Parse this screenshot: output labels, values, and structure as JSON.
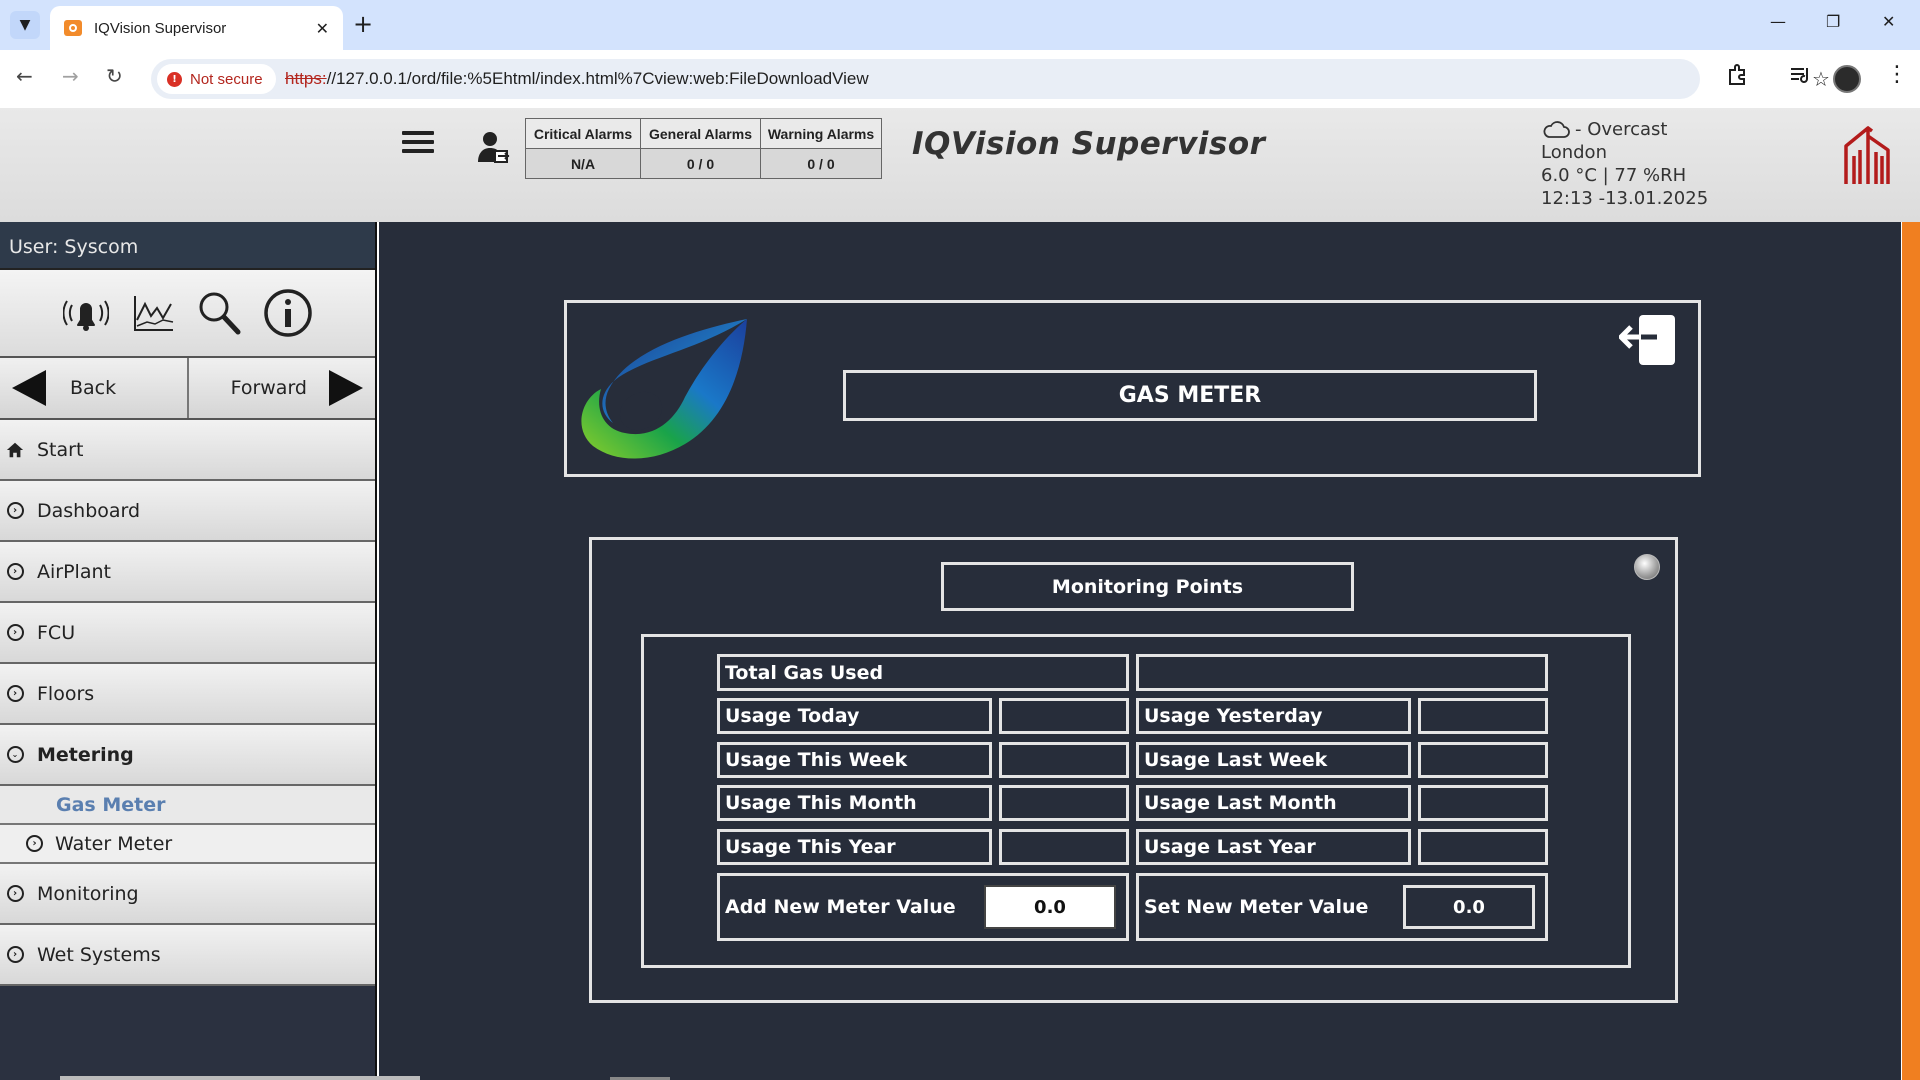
{
  "browser": {
    "tab_title": "IQVision Supervisor",
    "security_label": "Not secure",
    "url_scheme": "https:",
    "url_rest": "//127.0.0.1/ord/file:%5Ehtml/index.html%7Cview:web:FileDownloadView"
  },
  "header": {
    "brand": "IQVision Supervisor",
    "alarms": {
      "headers": [
        "Critical Alarms",
        "General Alarms",
        "Warning Alarms"
      ],
      "values": [
        "N/A",
        "0 / 0",
        "0 / 0"
      ]
    },
    "weather": {
      "condition": "- Overcast",
      "city": "London",
      "reading": "6.0 °C | 77 %RH",
      "datetime": "12:13 -13.01.2025"
    }
  },
  "sidebar": {
    "user": "User: Syscom",
    "back_label": "Back",
    "forward_label": "Forward",
    "items": [
      {
        "label": "Start"
      },
      {
        "label": "Dashboard"
      },
      {
        "label": "AirPlant"
      },
      {
        "label": "FCU"
      },
      {
        "label": "Floors"
      },
      {
        "label": "Metering"
      },
      {
        "label": "Gas Meter"
      },
      {
        "label": "Water Meter"
      },
      {
        "label": "Monitoring"
      },
      {
        "label": "Wet Systems"
      }
    ]
  },
  "main": {
    "page_title": "GAS METER",
    "monitoring_title": "Monitoring Points",
    "total_label": "Total Gas Used",
    "total_value": "",
    "rows": [
      {
        "left_label": "Usage Today",
        "left_value": "",
        "right_label": "Usage Yesterday",
        "right_value": ""
      },
      {
        "left_label": "Usage This Week",
        "left_value": "",
        "right_label": "Usage Last Week",
        "right_value": ""
      },
      {
        "left_label": "Usage This Month",
        "left_value": "",
        "right_label": "Usage Last Month",
        "right_value": ""
      },
      {
        "left_label": "Usage This Year",
        "left_value": "",
        "right_label": "Usage Last Year",
        "right_value": ""
      }
    ],
    "add_label": "Add New Meter Value",
    "add_value": "0.0",
    "set_label": "Set New Meter Value",
    "set_value": "0.0"
  },
  "colors": {
    "content_bg": "#272d3a",
    "scroll_accent": "#f07f20",
    "brand_red": "#b3261e"
  }
}
